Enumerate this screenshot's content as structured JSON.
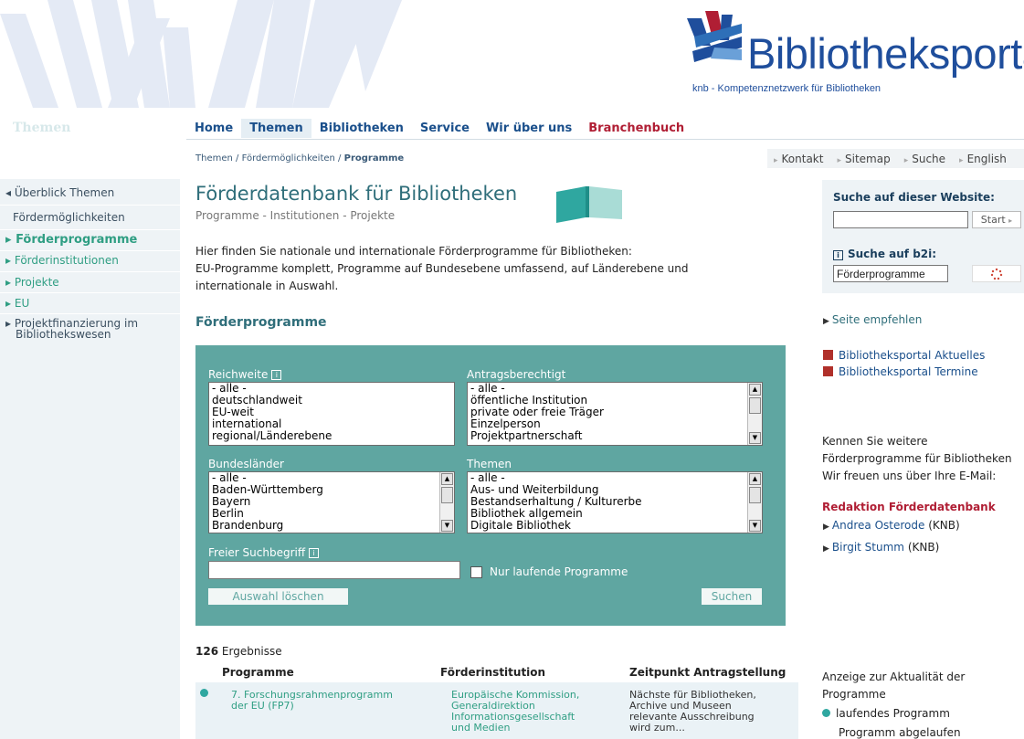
{
  "header": {
    "logo_text": "Bibliotheksportal",
    "logo_sub": "knb - Kompetenznetzwerk für Bibliotheken"
  },
  "nav": {
    "section_title": "Themen",
    "items": [
      {
        "label": "Home"
      },
      {
        "label": "Themen"
      },
      {
        "label": "Bibliotheken"
      },
      {
        "label": "Service"
      },
      {
        "label": "Wir über uns"
      },
      {
        "label": "Branchenbuch"
      }
    ]
  },
  "breadcrumb": {
    "part1": "Themen",
    "sep": "/",
    "part2": "Fördermöglichkeiten",
    "current": "Programme"
  },
  "utility": {
    "items": [
      "Kontakt",
      "Sitemap",
      "Suche",
      "English"
    ]
  },
  "sidebar": {
    "items": [
      {
        "label": "Überblick Themen",
        "prefix": "◂"
      },
      {
        "label": "Fördermöglichkeiten",
        "prefix": ""
      },
      {
        "label": "Förderprogramme",
        "prefix": "▸"
      },
      {
        "label": "Förderinstitutionen",
        "prefix": "▸"
      },
      {
        "label": "Projekte",
        "prefix": "▸"
      },
      {
        "label": "EU",
        "prefix": "▸"
      },
      {
        "label": "Projektfinanzierung im",
        "prefix": "▸"
      },
      {
        "label": "Bibliothekswesen",
        "prefix": ""
      }
    ]
  },
  "main": {
    "title": "Förderdatenbank für Bibliotheken",
    "subtitle": "Programme - Institutionen - Projekte",
    "intro_1": "Hier finden Sie nationale und internationale Förderprogramme für Bibliotheken:",
    "intro_2": "EU-Programme komplett, Programme auf Bundesebene umfassend, auf Länderebene und",
    "intro_3": "internationale in Auswahl.",
    "section_heading": "Förderprogramme"
  },
  "filter": {
    "reichweite_label": "Reichweite",
    "reichweite_options": [
      "- alle -",
      "deutschlandweit",
      "EU-weit",
      "international",
      "regional/Länderebene"
    ],
    "antrag_label": "Antragsberechtigt",
    "antrag_options": [
      "- alle -",
      "öffentliche Institution",
      "private oder freie Träger",
      "Einzelperson",
      "Projektpartnerschaft"
    ],
    "bundeslaender_label": "Bundesländer",
    "bundeslaender_options": [
      "- alle -",
      "Baden-Württemberg",
      "Bayern",
      "Berlin",
      "Brandenburg"
    ],
    "themen_label": "Themen",
    "themen_options": [
      "- alle -",
      "Aus- und Weiterbildung",
      "Bestandserhaltung / Kulturerbe",
      "Bibliothek allgemein",
      "Digitale Bibliothek"
    ],
    "free_label": "Freier Suchbegriff",
    "free_value": "",
    "running_label": "Nur laufende Programme",
    "reset_label": "Auswahl löschen",
    "search_label": "Suchen",
    "info_glyph": "i"
  },
  "results": {
    "count": "126",
    "count_label": "Ergebnisse",
    "col_programme": "Programme",
    "col_institution": "Förderinstitution",
    "col_time": "Zeitpunkt Antragstellung",
    "rows": [
      {
        "programme": [
          "7. Forschungsrahmenprogramm",
          "der EU (FP7)"
        ],
        "institution": [
          "Europäische Kommission,",
          "Generaldirektion",
          "Informationsgesellschaft",
          "und Medien"
        ],
        "time": [
          "Nächste für Bibliotheken,",
          "Archive und Museen",
          "relevante Ausschreibung",
          "wird zum..."
        ]
      }
    ]
  },
  "right": {
    "site_search_title": "Suche auf dieser Website:",
    "site_search_value": "",
    "site_search_button": "Start",
    "b2i_title": "Suche auf b2i:",
    "b2i_value": "Förderprogramme",
    "recommend": "Seite empfehlen",
    "rss_1": "Bibliotheksportal Aktuelles",
    "rss_2": "Bibliotheksportal Termine",
    "know_1": "Kennen Sie weitere",
    "know_2": "Förderprogramme für Bibliotheken",
    "know_3": "Wir freuen uns über Ihre E-Mail:",
    "redaktion": "Redaktion Förderdatenbank",
    "contact_1_name": "Andrea Osterode",
    "contact_1_org": "(KNB)",
    "contact_2_name": "Birgit Stumm",
    "contact_2_org": "(KNB)",
    "legend_1": "Anzeige zur Aktualität der",
    "legend_2": "Programme",
    "legend_running": "laufendes Programm",
    "legend_expired": "Programm abgelaufen"
  },
  "colors": {
    "brand_blue": "#1f4e9c",
    "teal_panel": "#5fa6a1",
    "nav_red": "#b01e34",
    "link_green": "#2f9e83"
  }
}
